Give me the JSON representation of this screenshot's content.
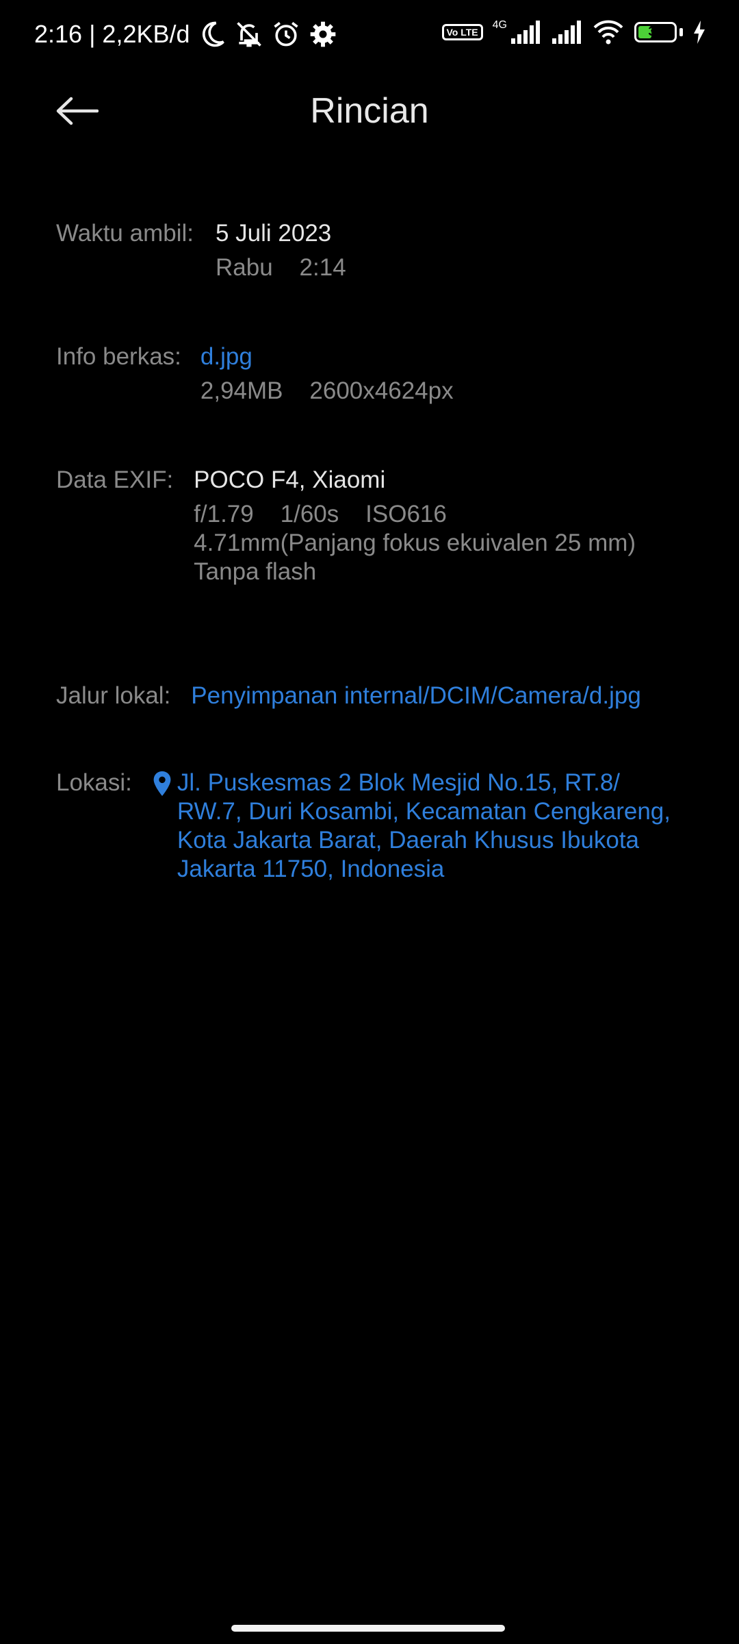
{
  "status_bar": {
    "time_speed": "2:16 | 2,2KB/d",
    "icons_left": [
      "moon-icon",
      "bell-off-icon",
      "alarm-icon",
      "gear-icon"
    ],
    "volte_label": "Vo LTE",
    "network_label": "4G",
    "battery_level": "37",
    "battery_percent": 37
  },
  "app_bar": {
    "title": "Rincian"
  },
  "details": {
    "time_taken": {
      "label": "Waktu ambil:",
      "date": "5 Juli 2023",
      "day_time": "Rabu    2:14"
    },
    "file_info": {
      "label": "Info berkas:",
      "name": "d.jpg",
      "size_dim": "2,94MB    2600x4624px"
    },
    "exif": {
      "label": "Data EXIF:",
      "device": "POCO F4, Xiaomi",
      "exposure": "f/1.79    1/60s    ISO616",
      "focal": "4.71mm(Panjang fokus ekuivalen 25 mm)",
      "flash": "Tanpa flash"
    },
    "local_path": {
      "label": "Jalur lokal:",
      "path": "Penyimpanan internal/DCIM/Camera/d.jpg"
    },
    "location": {
      "label": "Lokasi:",
      "lines": [
        "Jl. Puskesmas 2 Blok Mesjid No.15, RT.8/",
        "RW.7, Duri Kosambi, Kecamatan Cengkareng,",
        "Kota Jakarta Barat, Daerah Khusus Ibukota",
        "Jakarta 11750, Indonesia"
      ]
    }
  },
  "colors": {
    "background": "#000000",
    "link": "#2f7fdc",
    "label_gray": "#8a8a8a",
    "battery_green": "#4cd137"
  }
}
